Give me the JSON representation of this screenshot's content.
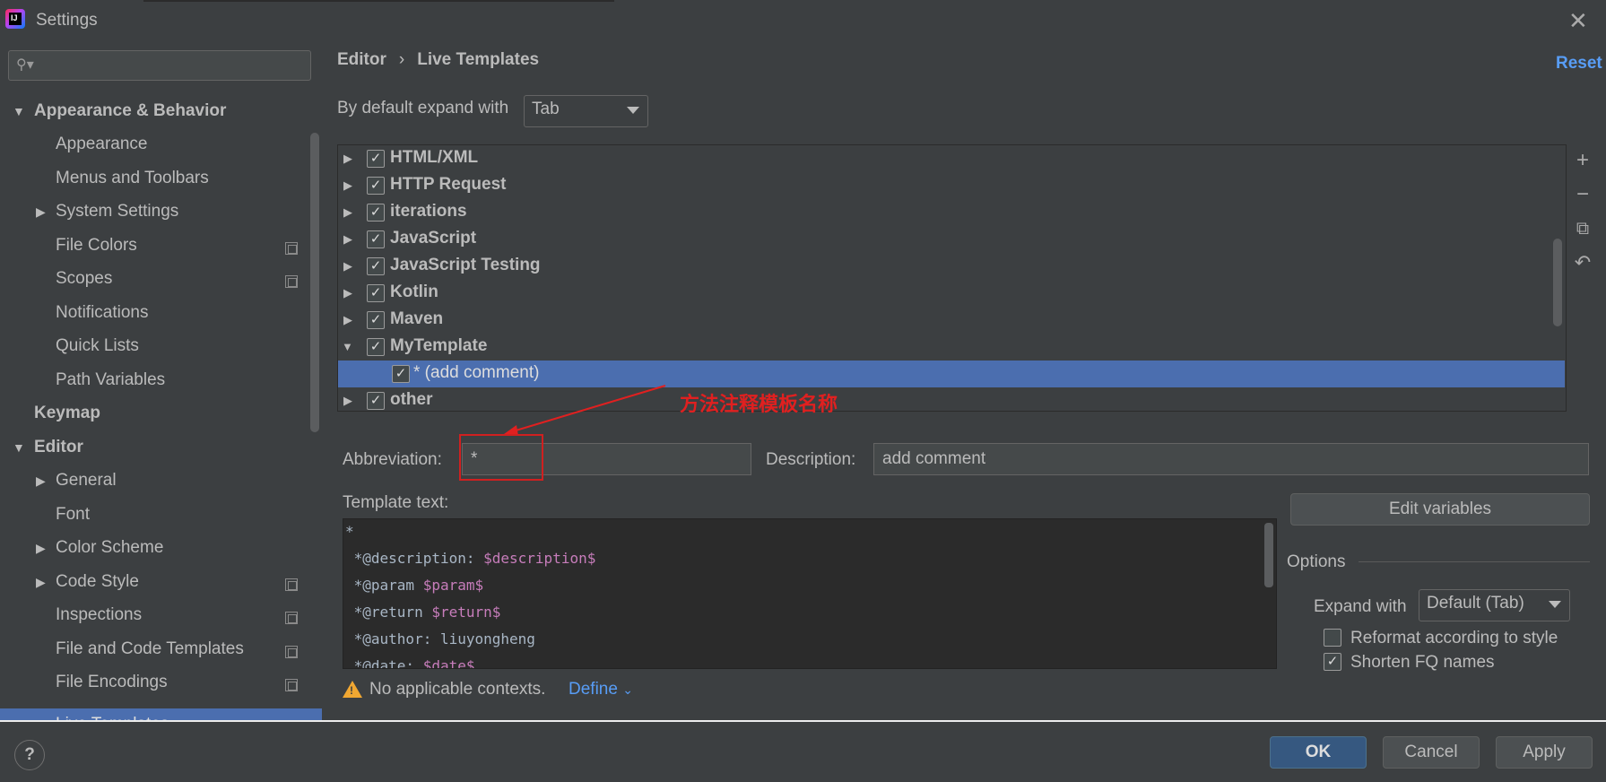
{
  "window": {
    "title": "Settings"
  },
  "search": {
    "placeholder": ""
  },
  "sidebar": {
    "items": [
      {
        "label": "Appearance & Behavior"
      },
      {
        "label": "Appearance"
      },
      {
        "label": "Menus and Toolbars"
      },
      {
        "label": "System Settings"
      },
      {
        "label": "File Colors"
      },
      {
        "label": "Scopes"
      },
      {
        "label": "Notifications"
      },
      {
        "label": "Quick Lists"
      },
      {
        "label": "Path Variables"
      },
      {
        "label": "Keymap"
      },
      {
        "label": "Editor"
      },
      {
        "label": "General"
      },
      {
        "label": "Font"
      },
      {
        "label": "Color Scheme"
      },
      {
        "label": "Code Style"
      },
      {
        "label": "Inspections"
      },
      {
        "label": "File and Code Templates"
      },
      {
        "label": "File Encodings"
      },
      {
        "label": "Live Templates"
      }
    ]
  },
  "breadcrumb": {
    "parent": "Editor",
    "separator": "›",
    "current": "Live Templates"
  },
  "reset_label": "Reset",
  "expand_default": {
    "label": "By default expand with",
    "value": "Tab"
  },
  "template_groups": [
    {
      "label": "HTML/XML",
      "checked": true
    },
    {
      "label": "HTTP Request",
      "checked": true
    },
    {
      "label": "iterations",
      "checked": true
    },
    {
      "label": "JavaScript",
      "checked": true
    },
    {
      "label": "JavaScript Testing",
      "checked": true
    },
    {
      "label": "Kotlin",
      "checked": true
    },
    {
      "label": "Maven",
      "checked": true
    },
    {
      "label": "MyTemplate",
      "checked": true,
      "expanded": true
    },
    {
      "label": "* (add comment)",
      "checked": true,
      "child": true,
      "selected": true
    },
    {
      "label": "other",
      "checked": true
    }
  ],
  "annotation": {
    "text": "方法注释模板名称"
  },
  "abbreviation": {
    "label": "Abbreviation:",
    "value": "*"
  },
  "description": {
    "label": "Description:",
    "value": "add comment"
  },
  "template_text": {
    "label": "Template text:",
    "lines": [
      {
        "text": "*",
        "var": ""
      },
      {
        "text": " *@description: ",
        "var": "$description$"
      },
      {
        "text": " *@param ",
        "var": "$param$"
      },
      {
        "text": " *@return ",
        "var": "$return$"
      },
      {
        "text": " *@author: liuyongheng",
        "var": ""
      },
      {
        "text": " *@date: ",
        "var": "$date$"
      }
    ]
  },
  "edit_variables_label": "Edit variables",
  "options": {
    "title": "Options",
    "expand_with_label": "Expand with",
    "expand_with_value": "Default (Tab)",
    "reformat_label": "Reformat according to style",
    "reformat_checked": false,
    "shorten_label": "Shorten FQ names",
    "shorten_checked": true
  },
  "contexts": {
    "warning": "No applicable contexts.",
    "define_label": "Define"
  },
  "footer": {
    "help": "?",
    "ok": "OK",
    "cancel": "Cancel",
    "apply": "Apply"
  },
  "colors": {
    "accent": "#4b6eaf",
    "link": "#589df6",
    "annotation": "#e02020",
    "warning": "#f0a732"
  }
}
